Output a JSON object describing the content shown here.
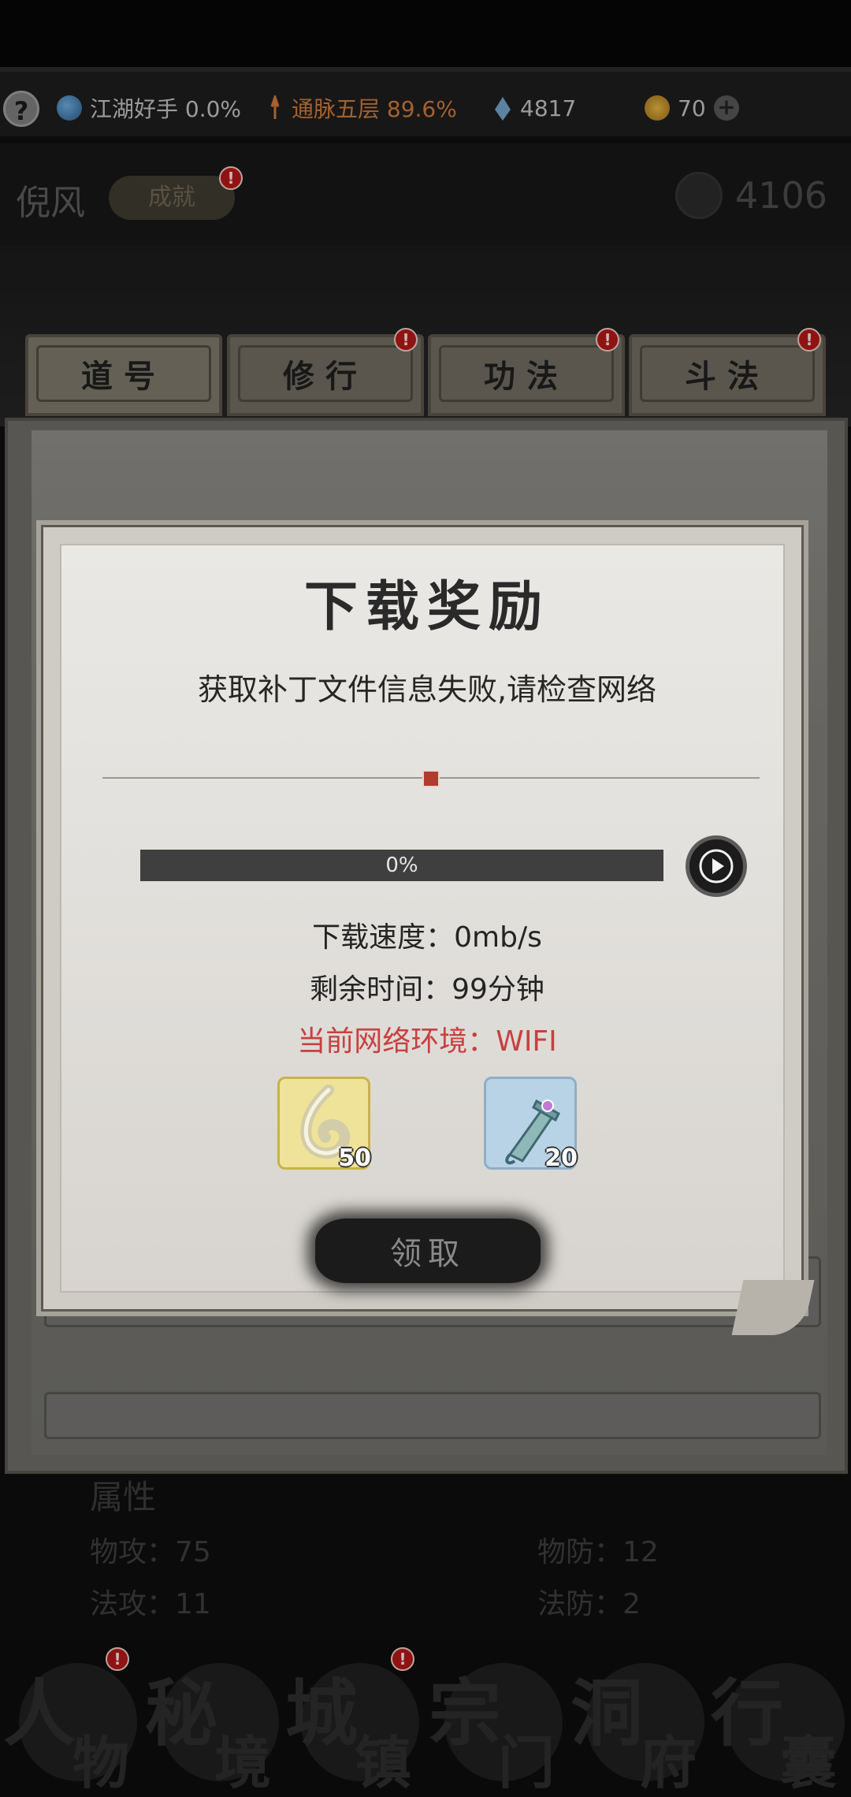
{
  "topbar": {
    "help_label": "?",
    "reputation": "江湖好手 0.0%",
    "cultivation": "通脉五层 89.6%",
    "spirit_stones": "4817",
    "coins": "70",
    "plus_label": "+"
  },
  "header": {
    "character_name": "倪风",
    "achievement_button": "成就",
    "badge": "!",
    "power": "4106"
  },
  "tabs": [
    {
      "label": "道号"
    },
    {
      "label": "修行"
    },
    {
      "label": "功法"
    },
    {
      "label": "斗法"
    }
  ],
  "attributes": {
    "title": "属性",
    "phys_atk": "物攻：75",
    "phys_def": "物防：12",
    "magic_atk": "法攻：11",
    "magic_def": "法防：2"
  },
  "bottom_nav": [
    {
      "big": "人",
      "small": "物"
    },
    {
      "big": "秘",
      "small": "境"
    },
    {
      "big": "城",
      "small": "镇"
    },
    {
      "big": "宗",
      "small": "门"
    },
    {
      "big": "洞",
      "small": "府"
    },
    {
      "big": "行",
      "small": "囊"
    }
  ],
  "modal": {
    "title": "下载奖励",
    "message": "获取补丁文件信息失败,请检查网络",
    "progress_value": 0,
    "progress_text": "0%",
    "speed": "下载速度：0mb/s",
    "remaining": "剩余时间：99分钟",
    "network": "当前网络环境：WIFI",
    "rewards": [
      {
        "icon": "jade-pendant-icon",
        "count": "50"
      },
      {
        "icon": "sword-hilt-icon",
        "count": "20"
      }
    ],
    "claim_label": "领取"
  },
  "colors": {
    "accent_red": "#c84040",
    "cultivation_orange": "#c8773a",
    "badge_red": "#b01818"
  }
}
